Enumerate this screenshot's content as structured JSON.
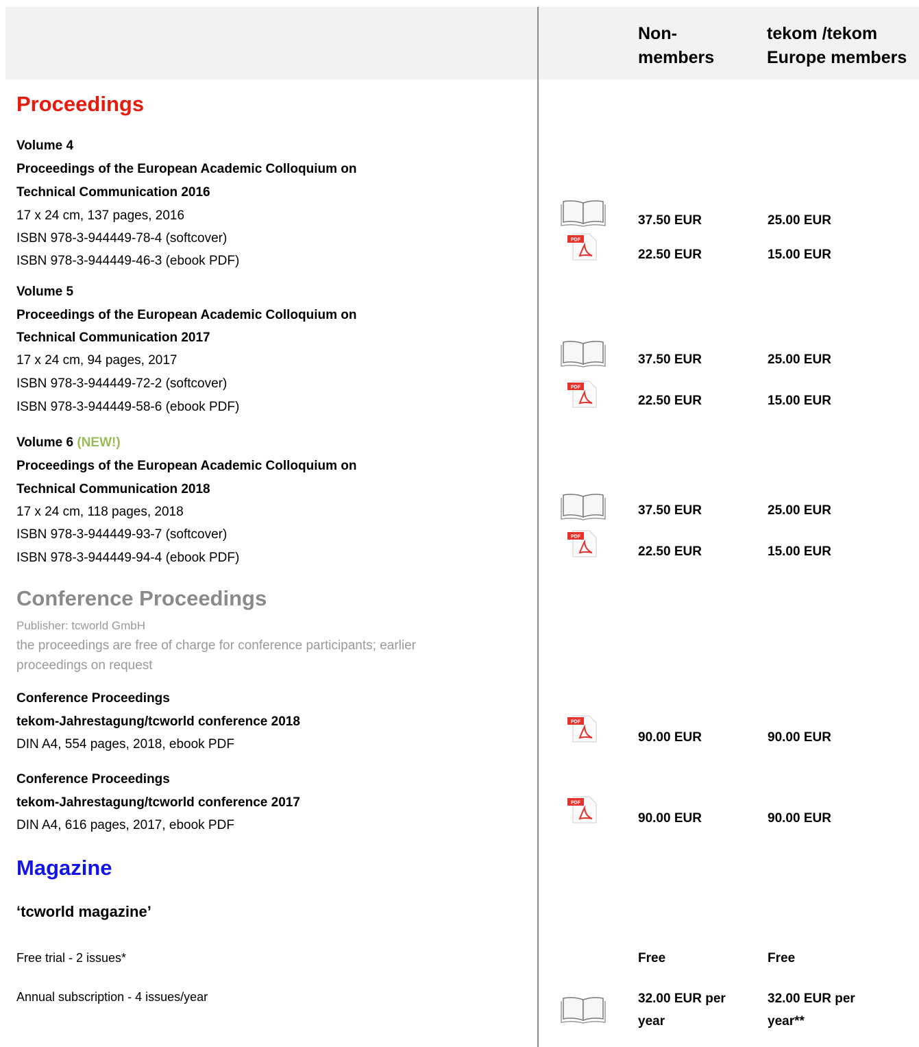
{
  "header": {
    "col_nonmembers": [
      "Non-",
      "members"
    ],
    "col_members": [
      "tekom /tekom",
      "Europe members"
    ]
  },
  "proceedings": {
    "title": "Proceedings",
    "volumes": [
      {
        "volume": "Volume 4",
        "new_tag": "",
        "title_lines": [
          "Proceedings of the European Academic Colloquium on",
          "Technical Communication 2016"
        ],
        "details": "17 x 24 cm, 137 pages, 2016",
        "isbn_soft": "ISBN 978-3-944449-78-4 (softcover)",
        "isbn_pdf": "ISBN 978-3-944449-46-3 (ebook PDF)",
        "price_soft_non": "37.50 EUR",
        "price_soft_mem": "25.00 EUR",
        "price_pdf_non": "22.50 EUR",
        "price_pdf_mem": "15.00 EUR"
      },
      {
        "volume": "Volume 5",
        "new_tag": "",
        "title_lines": [
          "Proceedings of the European Academic Colloquium on",
          "Technical Communication 2017"
        ],
        "details": "17 x 24 cm, 94 pages, 2017",
        "isbn_soft": "ISBN 978-3-944449-72-2 (softcover)",
        "isbn_pdf": "ISBN 978-3-944449-58-6 (ebook PDF)",
        "price_soft_non": "37.50 EUR",
        "price_soft_mem": "25.00 EUR",
        "price_pdf_non": "22.50 EUR",
        "price_pdf_mem": "15.00 EUR"
      },
      {
        "volume": "Volume 6",
        "new_tag": "(NEW!)",
        "title_lines": [
          "Proceedings of the European Academic Colloquium on",
          "Technical Communication 2018"
        ],
        "details": "17 x 24 cm, 118 pages, 2018",
        "isbn_soft": "ISBN 978-3-944449-93-7 (softcover)",
        "isbn_pdf": "ISBN 978-3-944449-94-4 (ebook PDF)",
        "price_soft_non": "37.50 EUR",
        "price_soft_mem": "25.00 EUR",
        "price_pdf_non": "22.50 EUR",
        "price_pdf_mem": "15.00 EUR"
      }
    ]
  },
  "conference": {
    "title": "Conference Proceedings",
    "publisher": "Publisher: tcworld GmbH",
    "note_lines": [
      "the proceedings are free of charge for conference participants; earlier",
      "proceedings on request"
    ],
    "items": [
      {
        "label": "Conference Proceedings",
        "name": "tekom-Jahrestagung/tcworld conference 2018",
        "details": "DIN A4, 554 pages, 2018, ebook PDF",
        "price_non": "90.00 EUR",
        "price_mem": "90.00 EUR"
      },
      {
        "label": "Conference Proceedings",
        "name": "tekom-Jahrestagung/tcworld conference 2017",
        "details": "DIN A4, 616 pages, 2017, ebook PDF",
        "price_non": "90.00 EUR",
        "price_mem": "90.00 EUR"
      }
    ]
  },
  "magazine": {
    "title": "Magazine",
    "name": "‘tcworld magazine’",
    "trial": "Free trial - 2 issues*",
    "trial_non": "Free",
    "trial_mem": "Free",
    "annual": "Annual subscription - 4 issues/year",
    "annual_non": [
      "32.00 EUR per",
      "year"
    ],
    "annual_mem": [
      "32.00 EUR per",
      "year**"
    ]
  },
  "icons": {
    "book": "open-book-icon",
    "pdf": "pdf-file-icon",
    "pdf_badge": "PDF",
    "pdf_red": "#e5322d"
  }
}
